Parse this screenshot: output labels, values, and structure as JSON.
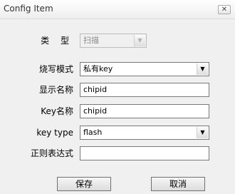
{
  "window": {
    "title": "Config Item"
  },
  "form": {
    "type": {
      "label": "类 型",
      "value": "扫描"
    },
    "burn_mode": {
      "label": "烧写模式",
      "value": "私有key"
    },
    "display_name": {
      "label": "显示名称",
      "value": "chipid"
    },
    "key_name": {
      "label": "Key名称",
      "value": "chipid"
    },
    "key_type": {
      "label": "key type",
      "value": "flash"
    },
    "regex": {
      "label": "正则表达式",
      "value": ""
    }
  },
  "buttons": {
    "save": "保存",
    "cancel": "取消"
  }
}
